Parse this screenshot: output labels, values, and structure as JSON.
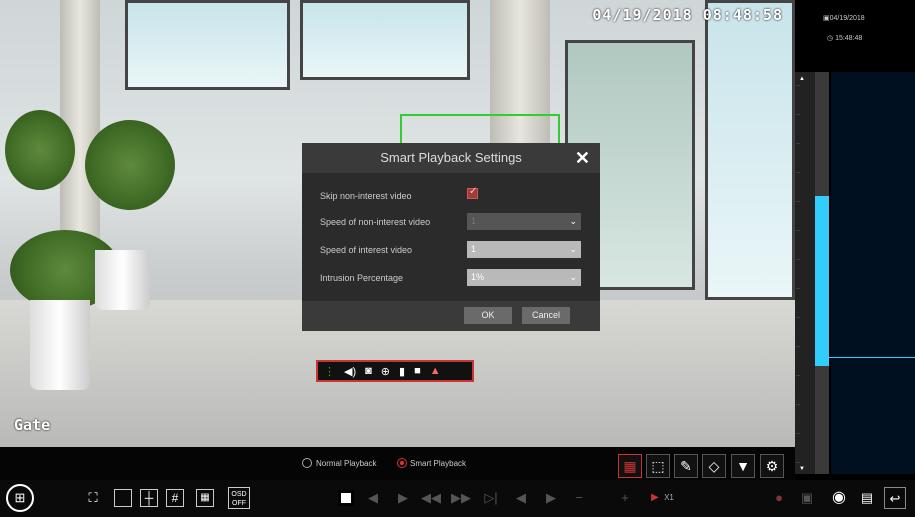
{
  "video": {
    "timestamp": "04/19/2018 08:48:58",
    "channel_label": "Gate"
  },
  "dialog": {
    "title": "Smart Playback Settings",
    "close_icon": "close-icon",
    "rows": [
      {
        "label": "Skip non-interest video",
        "type": "checkbox",
        "checked": true
      },
      {
        "label": "Speed of non-interest video",
        "type": "select",
        "value": "1",
        "disabled": true
      },
      {
        "label": "Speed of interest video",
        "type": "select",
        "value": "1",
        "disabled": false
      },
      {
        "label": "Intrusion Percentage",
        "type": "select",
        "value": "1%",
        "disabled": false
      }
    ],
    "ok_label": "OK",
    "cancel_label": "Cancel"
  },
  "minibar": {
    "icons": [
      "drag-handle-icon",
      "volume-icon",
      "camera-icon",
      "zoom-icon",
      "bookmark-icon",
      "record-icon",
      "chart-icon"
    ]
  },
  "right_panel": {
    "date": "04/19/2018",
    "time": "15:48:48"
  },
  "modebar": {
    "normal_label": "Normal Playback",
    "smart_label": "Smart Playback",
    "selected": "smart"
  },
  "bottombar": {
    "osd_label": "OSD",
    "osd_state": "OFF",
    "speed_label": "X1"
  },
  "colors": {
    "accent": "#cc3333",
    "record": "#33ccff",
    "dialog_bg": "#2b2b2b"
  }
}
